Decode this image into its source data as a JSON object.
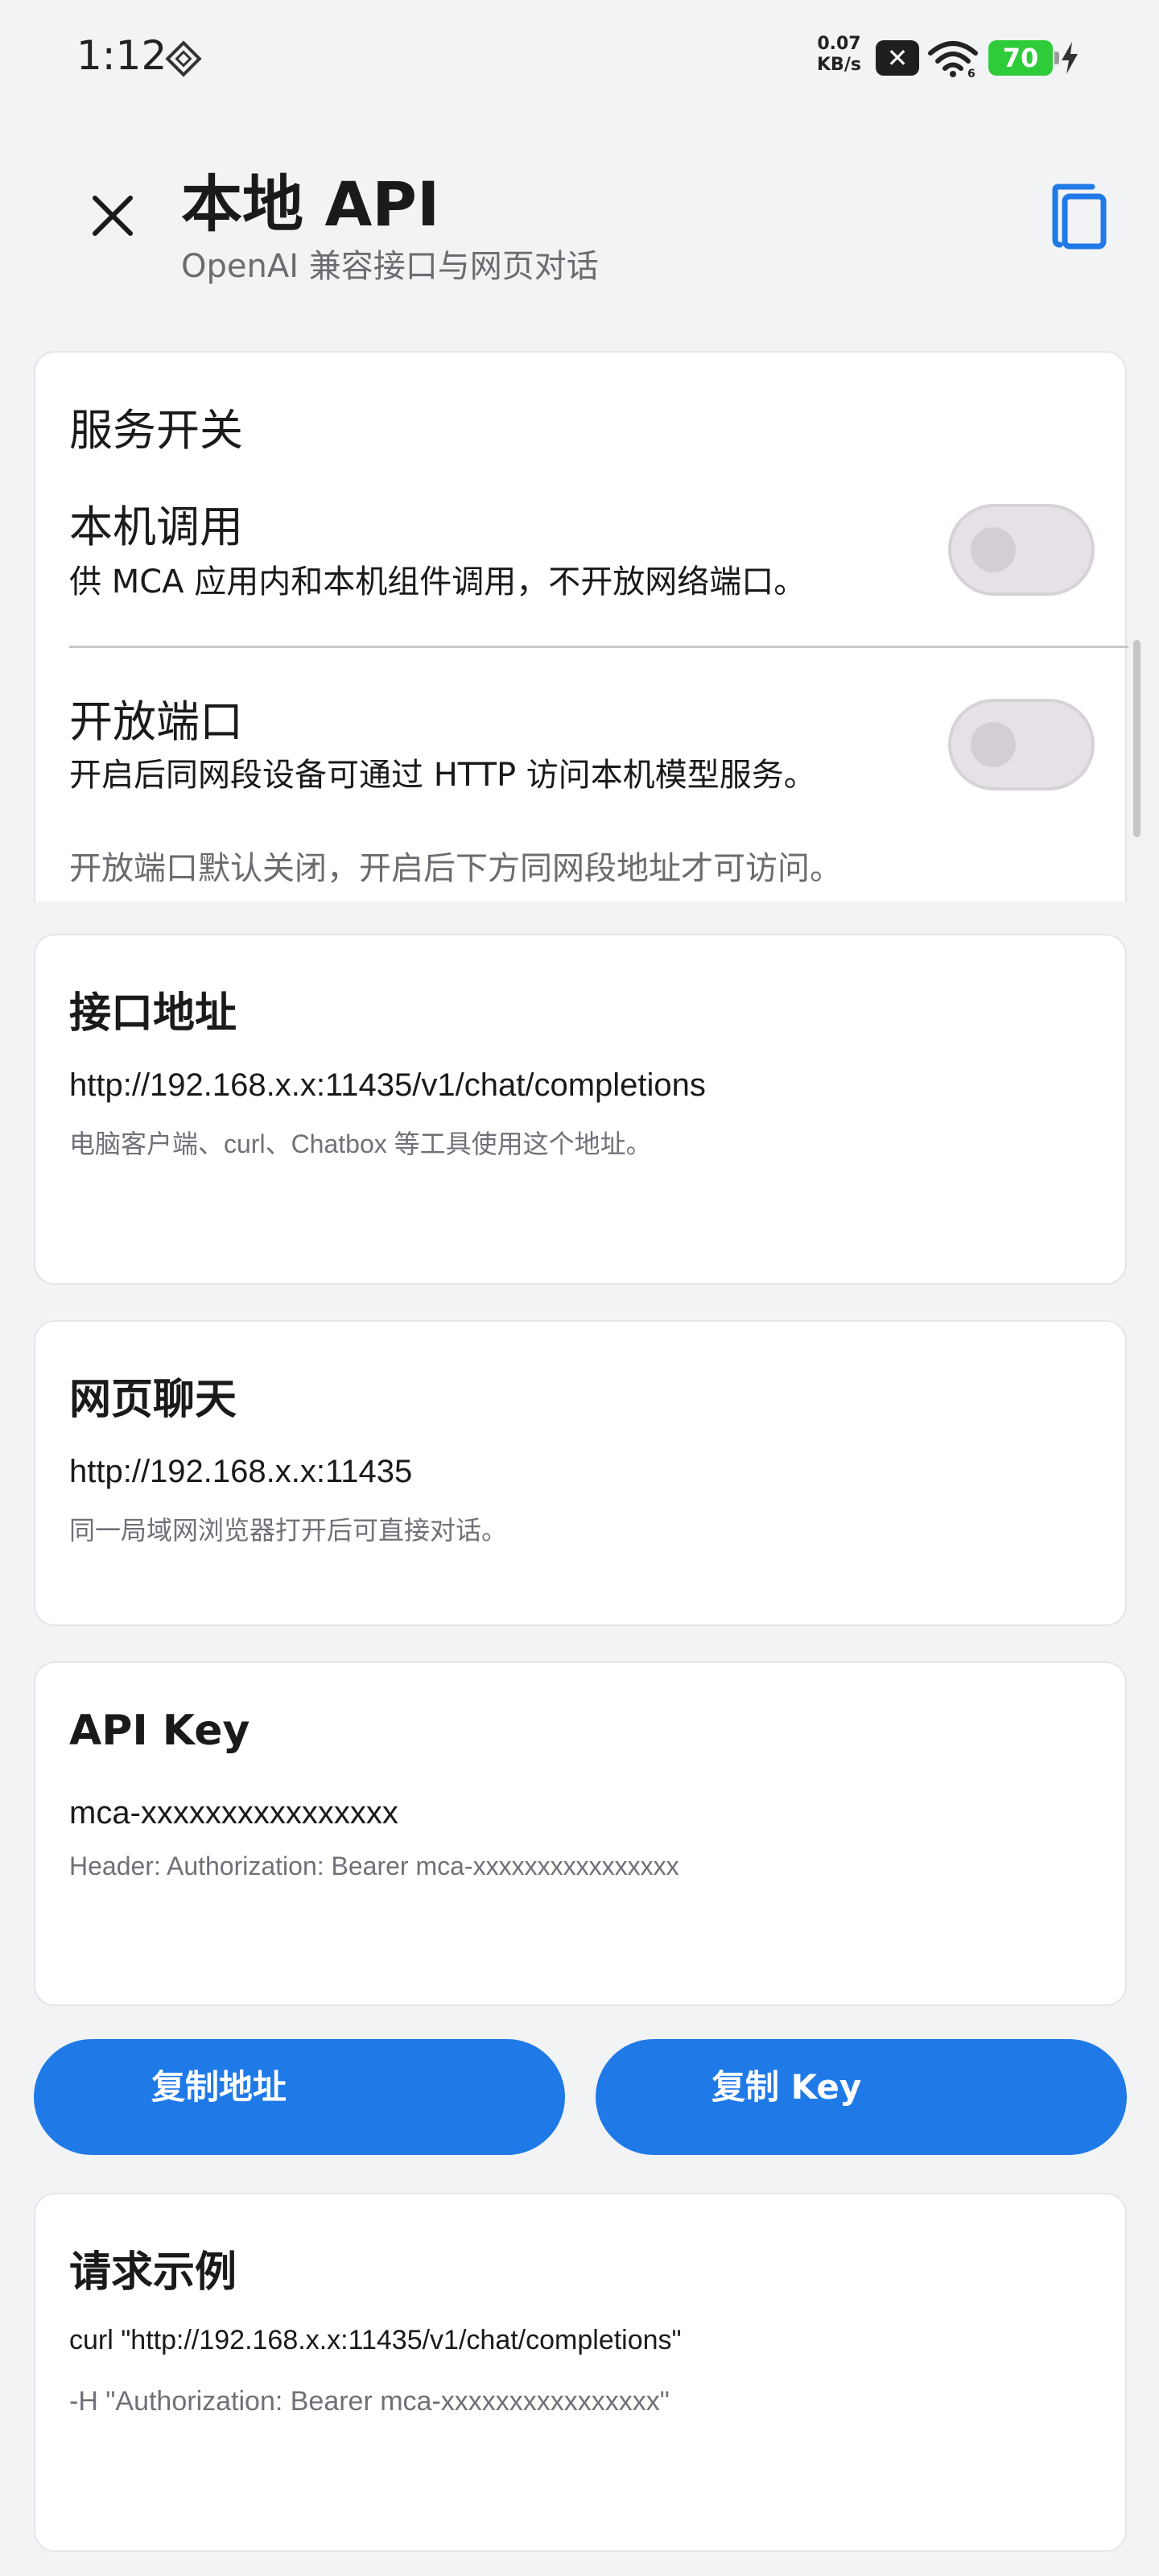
{
  "status_bar": {
    "time": "1:12",
    "net_speed_value": "0.07",
    "net_speed_unit": "KB/s",
    "battery": "70",
    "icons": [
      "cast-icon",
      "close-badge-icon",
      "wifi-icon",
      "battery-icon",
      "charging-bolt-icon"
    ]
  },
  "header": {
    "title": "本地 API",
    "subtitle": "OpenAI 兼容接口与网页对话",
    "close_icon": "close-icon",
    "copy_icon": "copy-icon"
  },
  "service": {
    "title": "服务开关",
    "local_call": {
      "title": "本机调用",
      "desc": "供 MCA 应用内和本机组件调用，不开放网络端口。",
      "enabled": false
    },
    "open_port": {
      "title": "开放端口",
      "desc": "开启后同网段设备可通过 HTTP 访问本机模型服务。",
      "enabled": false
    },
    "note": "开放端口默认关闭，开启后下方同网段地址才可访问。"
  },
  "endpoint": {
    "title": "接口地址",
    "value": "http://192.168.x.x:11435/v1/chat/completions",
    "hint": "电脑客户端、curl、Chatbox 等工具使用这个地址。"
  },
  "web_chat": {
    "title": "网页聊天",
    "value": "http://192.168.x.x:11435",
    "hint": "同一局域网浏览器打开后可直接对话。"
  },
  "api_key": {
    "title": "API Key",
    "value": "mca-xxxxxxxxxxxxxxxx",
    "hint": "Header: Authorization: Bearer mca-xxxxxxxxxxxxxxxx"
  },
  "buttons": {
    "copy_address": "复制地址",
    "copy_key": "复制 Key"
  },
  "example": {
    "title": "请求示例",
    "line1": "curl \"http://192.168.x.x:11435/v1/chat/completions\"",
    "line2": "-H \"Authorization: Bearer mca-xxxxxxxxxxxxxxxx\""
  },
  "colors": {
    "accent": "#1f7ae8",
    "background": "#f2f3f5",
    "card": "#ffffff",
    "battery": "#2fcc39"
  }
}
